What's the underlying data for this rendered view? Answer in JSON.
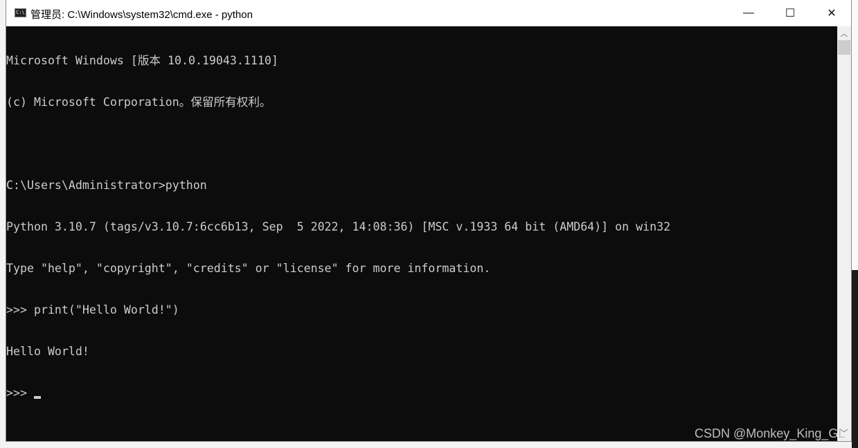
{
  "window": {
    "title": "管理员: C:\\Windows\\system32\\cmd.exe - python",
    "icon": "cmd-icon",
    "minimize_label": "—",
    "maximize_label": "☐",
    "close_label": "✕"
  },
  "terminal": {
    "lines": [
      "Microsoft Windows [版本 10.0.19043.1110]",
      "(c) Microsoft Corporation。保留所有权利。",
      "",
      "C:\\Users\\Administrator>python",
      "Python 3.10.7 (tags/v3.10.7:6cc6b13, Sep  5 2022, 14:08:36) [MSC v.1933 64 bit (AMD64)] on win32",
      "Type \"help\", \"copyright\", \"credits\" or \"license\" for more information.",
      ">>> print(\"Hello World!\")",
      "Hello World!"
    ],
    "prompt": ">>> "
  },
  "watermark": "CSDN @Monkey_King_GL",
  "colors": {
    "background": "#0c0c0c",
    "text": "#cccccc"
  }
}
